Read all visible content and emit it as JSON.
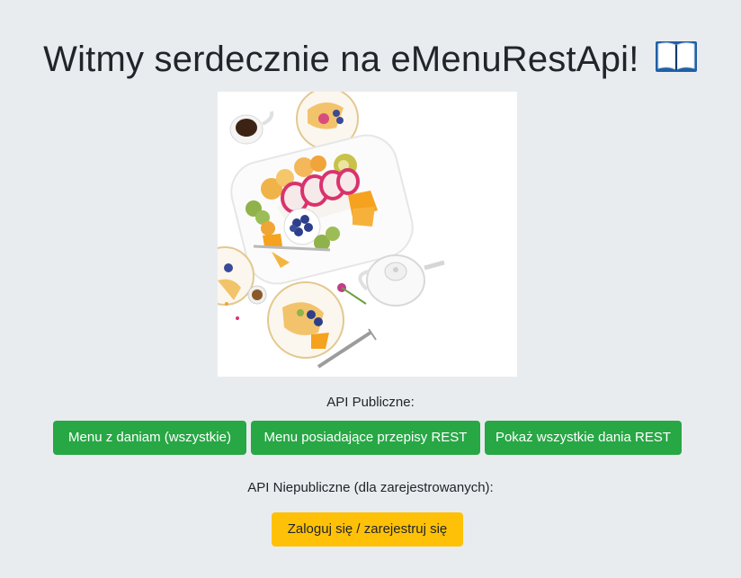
{
  "header": {
    "title": "Witmy serdecznie na eMenuRestApi!",
    "title_icon": "open-book-icon"
  },
  "hero": {
    "icon": "food-photo"
  },
  "public_api": {
    "label": "API Publiczne:",
    "buttons": [
      {
        "label": "Menu z daniam (wszystkie)"
      },
      {
        "label": "Menu posiadające przepisy REST"
      },
      {
        "label": "Pokaż wszystkie dania REST"
      }
    ],
    "button_color": "#28a745"
  },
  "private_api": {
    "label": "API Niepubliczne (dla zarejestrowanych):",
    "login_label": "Zaloguj się / zarejestruj się",
    "button_color": "#ffc107"
  },
  "colors": {
    "background": "#e9ecef",
    "text": "#212529"
  }
}
